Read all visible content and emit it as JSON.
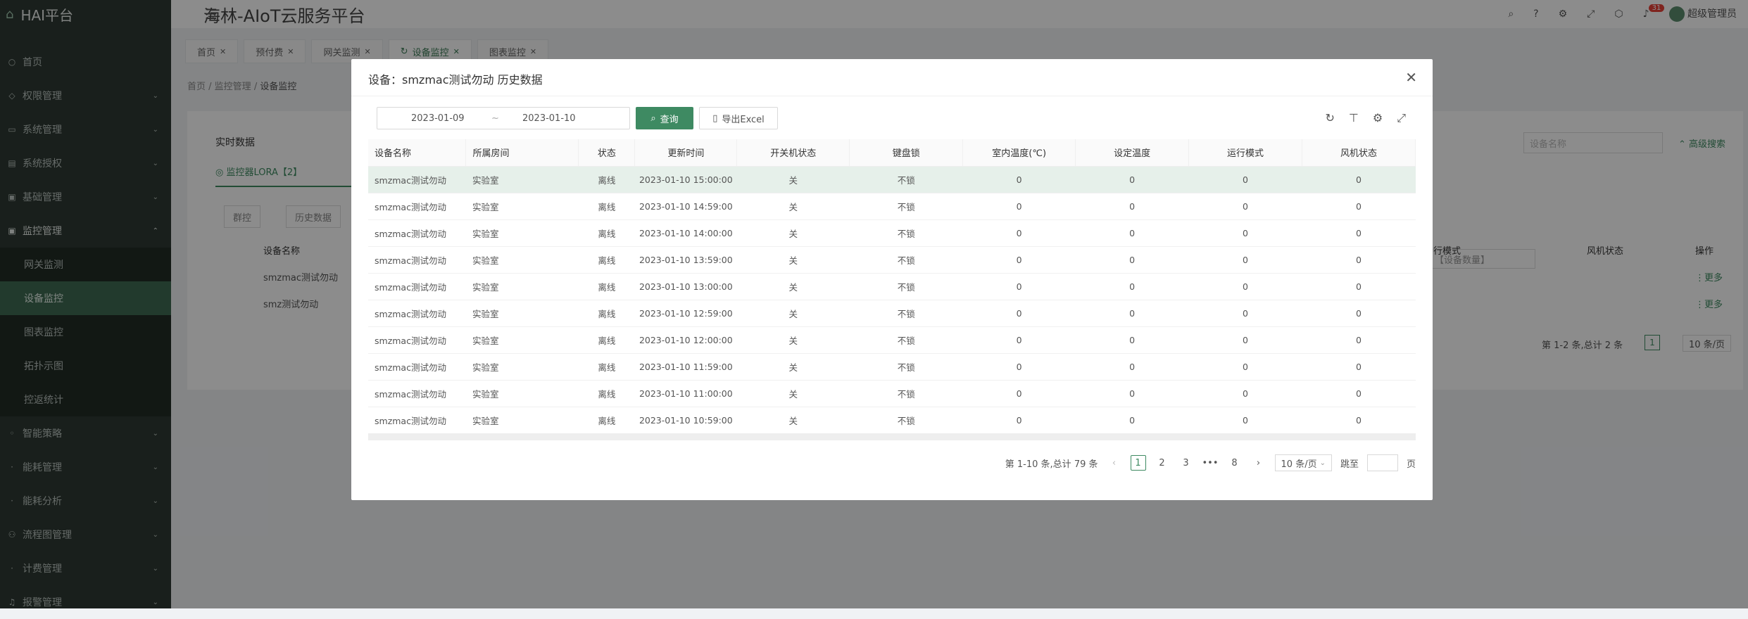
{
  "app": {
    "logo": "HAI平台",
    "title": "海林-AIoT云服务平台",
    "user": "超级管理员",
    "notif_count": "31"
  },
  "sidebar": {
    "items": [
      {
        "label": "首页",
        "icon": "home-icon"
      },
      {
        "label": "权限管理",
        "icon": "shield-icon"
      },
      {
        "label": "系统管理",
        "icon": "monitor-icon"
      },
      {
        "label": "系统授权",
        "icon": "key-icon"
      },
      {
        "label": "基础管理",
        "icon": "grid-icon"
      },
      {
        "label": "监控管理",
        "icon": "monitor-icon"
      }
    ],
    "sub": [
      {
        "label": "网关监测"
      },
      {
        "label": "设备监控"
      },
      {
        "label": "图表监控"
      },
      {
        "label": "拓扑示图"
      },
      {
        "label": "控返统计"
      }
    ],
    "after": [
      {
        "label": "智能策略"
      },
      {
        "label": "能耗管理"
      },
      {
        "label": "能耗分析"
      },
      {
        "label": "流程图管理"
      },
      {
        "label": "计费管理"
      },
      {
        "label": "报警管理"
      }
    ]
  },
  "tabs": [
    {
      "label": "首页"
    },
    {
      "label": "预付费"
    },
    {
      "label": "网关监测"
    },
    {
      "label": "设备监控"
    },
    {
      "label": "图表监控"
    }
  ],
  "breadcrumb": {
    "a": "首页",
    "b": "监控管理",
    "c": "设备监控"
  },
  "background": {
    "section": "实时数据",
    "subtab": "监控器LORA【2】",
    "btn1": "群控",
    "btn2": "历史数据",
    "col_name": "设备名称",
    "rows": [
      "smzmac测试勿动",
      "smz测试勿动"
    ],
    "col_mode": "行模式",
    "col_fan": "风机状态",
    "col_op": "操作",
    "more": "更多",
    "filter_count": "【设备数量】",
    "filter_name_ph": "设备名称",
    "adv_search": "高级搜索",
    "pager": "第 1-2 条,总计 2 条",
    "page": "1",
    "per": "10 条/页"
  },
  "modal": {
    "title": "设备：smzmac测试勿动 历史数据",
    "date_start": "2023-01-09",
    "date_sep": "~",
    "date_end": "2023-01-10",
    "query_label": "查询",
    "export_label": "导出Excel",
    "columns": [
      "设备名称",
      "所属房间",
      "状态",
      "更新时间",
      "开关机状态",
      "键盘锁",
      "室内温度(℃)",
      "设定温度",
      "运行模式",
      "风机状态"
    ],
    "rows": [
      [
        "smzmac测试勿动",
        "实验室",
        "离线",
        "2023-01-10 15:00:00",
        "关",
        "不锁",
        "0",
        "0",
        "0",
        "0"
      ],
      [
        "smzmac测试勿动",
        "实验室",
        "离线",
        "2023-01-10 14:59:00",
        "关",
        "不锁",
        "0",
        "0",
        "0",
        "0"
      ],
      [
        "smzmac测试勿动",
        "实验室",
        "离线",
        "2023-01-10 14:00:00",
        "关",
        "不锁",
        "0",
        "0",
        "0",
        "0"
      ],
      [
        "smzmac测试勿动",
        "实验室",
        "离线",
        "2023-01-10 13:59:00",
        "关",
        "不锁",
        "0",
        "0",
        "0",
        "0"
      ],
      [
        "smzmac测试勿动",
        "实验室",
        "离线",
        "2023-01-10 13:00:00",
        "关",
        "不锁",
        "0",
        "0",
        "0",
        "0"
      ],
      [
        "smzmac测试勿动",
        "实验室",
        "离线",
        "2023-01-10 12:59:00",
        "关",
        "不锁",
        "0",
        "0",
        "0",
        "0"
      ],
      [
        "smzmac测试勿动",
        "实验室",
        "离线",
        "2023-01-10 12:00:00",
        "关",
        "不锁",
        "0",
        "0",
        "0",
        "0"
      ],
      [
        "smzmac测试勿动",
        "实验室",
        "离线",
        "2023-01-10 11:59:00",
        "关",
        "不锁",
        "0",
        "0",
        "0",
        "0"
      ],
      [
        "smzmac测试勿动",
        "实验室",
        "离线",
        "2023-01-10 11:00:00",
        "关",
        "不锁",
        "0",
        "0",
        "0",
        "0"
      ],
      [
        "smzmac测试勿动",
        "实验室",
        "离线",
        "2023-01-10 10:59:00",
        "关",
        "不锁",
        "0",
        "0",
        "0",
        "0"
      ]
    ],
    "pager": {
      "summary": "第 1-10 条,总计 79 条",
      "pages": [
        "1",
        "2",
        "3",
        "•••",
        "8"
      ],
      "per_page": "10 条/页",
      "jump_label": "跳至",
      "page_unit": "页"
    }
  },
  "colors": {
    "primary": "#3e8a62",
    "sidebar": "#2e3a33",
    "active_menu": "#3f6b52"
  }
}
